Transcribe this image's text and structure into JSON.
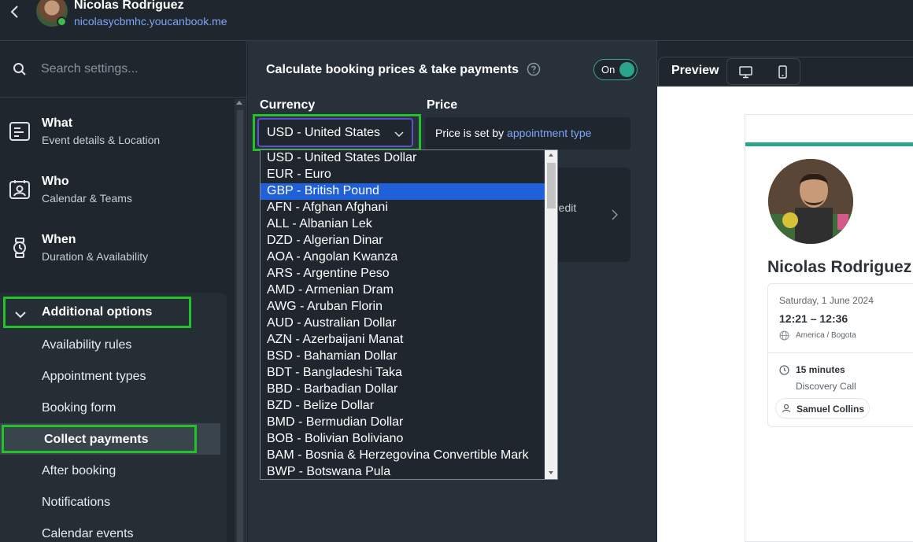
{
  "header": {
    "user_name": "Nicolas Rodriguez",
    "user_url": "nicolasycbmhc.youcanbook.me"
  },
  "sidebar": {
    "search_placeholder": "Search settings...",
    "items": [
      {
        "title": "What",
        "subtitle": "Event details & Location",
        "icon": "document-icon"
      },
      {
        "title": "Who",
        "subtitle": "Calendar & Teams",
        "icon": "contact-card-icon"
      },
      {
        "title": "When",
        "subtitle": "Duration & Availability",
        "icon": "watch-icon"
      }
    ],
    "additional": {
      "title": "Additional options",
      "subitems": [
        "Availability rules",
        "Appointment types",
        "Booking form",
        "Collect payments",
        "After booking",
        "Notifications",
        "Calendar events"
      ]
    }
  },
  "main": {
    "title": "Calculate booking prices & take payments",
    "toggle_label": "On",
    "currency_label": "Currency",
    "price_label": "Price",
    "currency_value": "USD - United States",
    "price_text": "Price is set by ",
    "price_link": "appointment type",
    "credit_text": "redit"
  },
  "dropdown": {
    "selected": "GBP - British Pound",
    "options": [
      "USD - United States Dollar",
      "EUR - Euro",
      "GBP - British Pound",
      "AFN - Afghan Afghani",
      "ALL - Albanian Lek",
      "DZD - Algerian Dinar",
      "AOA - Angolan Kwanza",
      "ARS - Argentine Peso",
      "AMD - Armenian Dram",
      "AWG - Aruban Florin",
      "AUD - Australian Dollar",
      "AZN - Azerbaijani Manat",
      "BSD - Bahamian Dollar",
      "BDT - Bangladeshi Taka",
      "BBD - Barbadian Dollar",
      "BZD - Belize Dollar",
      "BMD - Bermudian Dollar",
      "BOB - Bolivian Boliviano",
      "BAM - Bosnia & Herzegovina Convertible Mark",
      "BWP - Botswana Pula"
    ]
  },
  "preview": {
    "label": "Preview",
    "name": "Nicolas Rodriguez",
    "date": "Saturday, 1 June 2024",
    "time": "12:21 – 12:36",
    "timezone": "America / Bogota",
    "duration": "15 minutes",
    "event": "Discovery Call",
    "host": "Samuel Collins"
  },
  "colors": {
    "accent_green_highlight": "#21c22a",
    "teal": "#2aa58b",
    "link": "#7ea6f7",
    "selected_option": "#2060d8"
  }
}
